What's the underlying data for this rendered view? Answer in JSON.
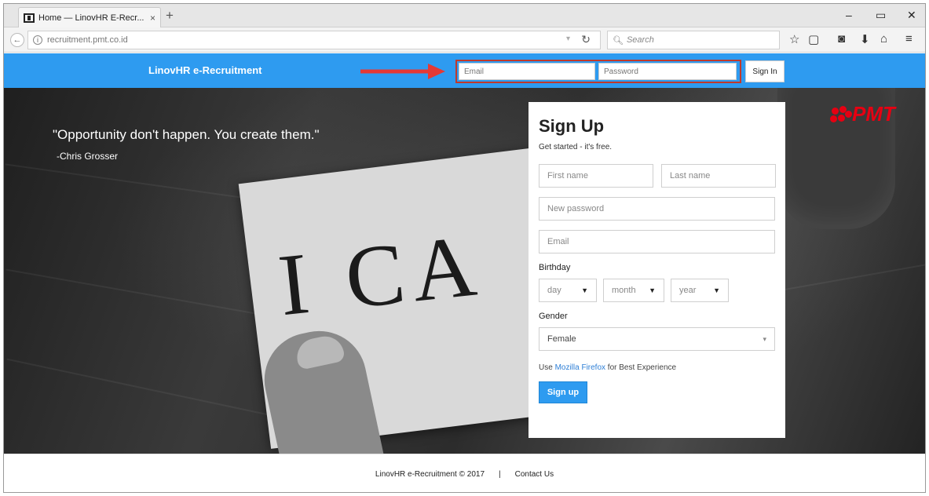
{
  "browser": {
    "tab_title": "Home — LinovHR E-Recr...",
    "tab_close": "×",
    "new_tab": "+",
    "url": "recruitment.pmt.co.id",
    "search_placeholder": "Search",
    "window_controls": [
      "–",
      "▭",
      "✕"
    ]
  },
  "header": {
    "brand": "LinovHR e-Recruitment",
    "email_placeholder": "Email",
    "password_placeholder": "Password",
    "signin_label": "Sign In"
  },
  "hero": {
    "quote": "\"Opportunity don't happen. You create them.\"",
    "author": "-Chris Grosser",
    "card_text": "I CA",
    "logo_text": "PMT"
  },
  "signup": {
    "title": "Sign Up",
    "subtitle": "Get started - it's free.",
    "first_name_placeholder": "First name",
    "last_name_placeholder": "Last name",
    "password_placeholder": "New password",
    "email_placeholder": "Email",
    "birthday_label": "Birthday",
    "day": "day",
    "month": "month",
    "year": "year",
    "gender_label": "Gender",
    "gender_value": "Female",
    "note_prefix": "Use ",
    "note_link": "Mozilla Firefox",
    "note_suffix": " for Best Experience",
    "button": "Sign up"
  },
  "footer": {
    "copyright": "LinovHR e-Recruitment © 2017",
    "separator": "|",
    "contact": "Contact Us"
  },
  "colors": {
    "brand_blue": "#2e9bf0",
    "highlight_red": "#c0392b",
    "logo_red": "#e60012"
  }
}
